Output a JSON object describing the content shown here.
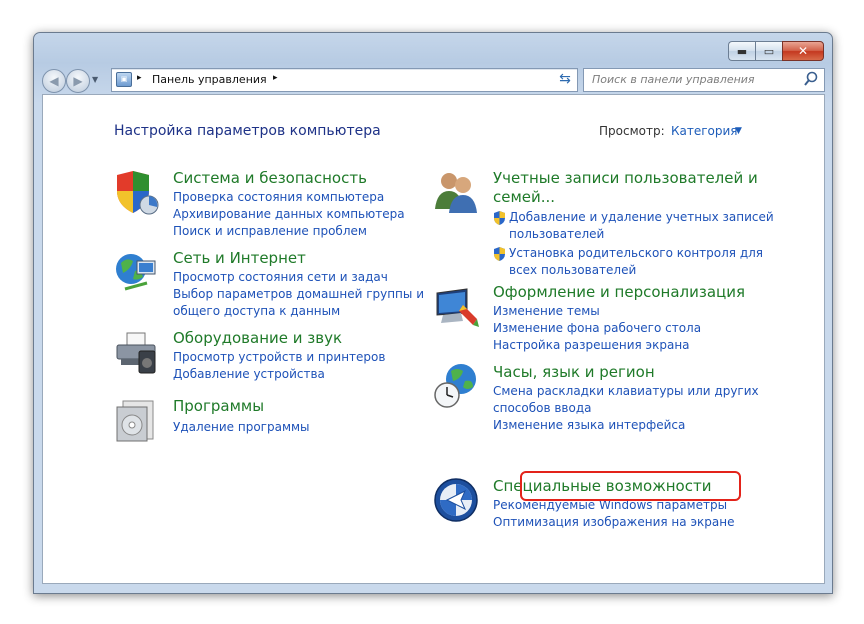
{
  "window": {
    "caption_buttons": {
      "minimize": "▬",
      "maximize": "▭",
      "close": "✕"
    }
  },
  "nav": {
    "back_icon": "back-arrow-icon",
    "forward_icon": "forward-arrow-icon",
    "address": {
      "sep": "▸",
      "path": "Панель управления",
      "sep_after": "▸",
      "dropdown": "▼"
    },
    "refresh_icon": "refresh-icon",
    "search_placeholder": "Поиск в панели управления"
  },
  "header": {
    "title": "Настройка параметров компьютера",
    "view_label": "Просмотр:",
    "view_value": "Категория",
    "view_arrow": "▼"
  },
  "categories_left": [
    {
      "title": "Система и безопасность",
      "icon": "shield-icon",
      "links": [
        "Проверка состояния компьютера",
        "Архивирование данных компьютера",
        "Поиск и исправление проблем"
      ]
    },
    {
      "title": "Сеть и Интернет",
      "icon": "globe-network-icon",
      "links": [
        "Просмотр состояния сети и задач",
        "Выбор параметров домашней группы и",
        "общего доступа к данным"
      ]
    },
    {
      "title": "Оборудование и звук",
      "icon": "printer-icon",
      "links": [
        "Просмотр устройств и принтеров",
        "Добавление устройства"
      ]
    },
    {
      "title": "Программы",
      "icon": "programs-icon",
      "links": [
        "Удаление программы"
      ]
    }
  ],
  "categories_right": [
    {
      "title_line1": "Учетные записи пользователей и",
      "title_line2": "семей...",
      "icon": "users-icon",
      "links": [
        {
          "line1": "Добавление и удаление учетных записей",
          "line2": "пользователей"
        },
        {
          "line1": "Установка родительского контроля для",
          "line2": "всех пользователей"
        }
      ]
    },
    {
      "title": "Оформление и персонализация",
      "icon": "display-icon",
      "links": [
        "Изменение темы",
        "Изменение фона рабочего стола",
        "Настройка разрешения экрана"
      ]
    },
    {
      "title": "Часы, язык и регион",
      "icon": "clock-globe-icon",
      "links": [
        "Смена раскладки клавиатуры или других",
        "способов ввода",
        "Изменение языка интерфейса"
      ]
    },
    {
      "title": "Специальные возможности",
      "icon": "accessibility-icon",
      "links": [
        "Рекомендуемые Windows параметры",
        "Оптимизация изображения на экране"
      ]
    }
  ],
  "colors": {
    "category_title": "#1f7a29",
    "link": "#1e52b8",
    "page_title": "#1e3287",
    "highlight": "#e3231a"
  }
}
